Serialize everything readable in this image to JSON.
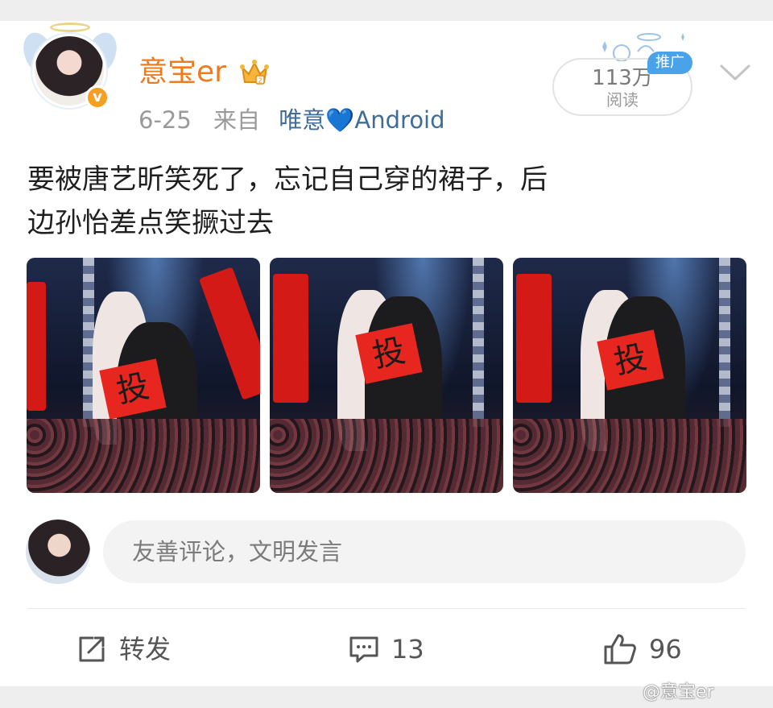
{
  "post": {
    "author": "意宝er",
    "date": "6-25",
    "source_prefix": "来自",
    "device_name": "唯意",
    "device_heart": "💙",
    "device_os": "Android",
    "views_count": "113万",
    "views_label": "阅读",
    "promo_badge": "推广",
    "text_line1": "要被唐艺昕笑死了，忘记自己穿的裙子，后",
    "text_line2": "边孙怡差点笑撅过去",
    "photos": [
      {
        "sign_char": "投"
      },
      {
        "sign_char": "投"
      },
      {
        "sign_char": "投"
      }
    ]
  },
  "comment": {
    "placeholder": "友善评论，文明发言"
  },
  "actions": {
    "repost_label": "转发",
    "comment_count": "13",
    "like_count": "96"
  },
  "watermark": "@意宝er",
  "colors": {
    "username": "#ef7b1f",
    "device_link": "#3f6d98",
    "promo": "#4aa3e8",
    "verified": "#f7a01f"
  },
  "icons": {
    "verified": "verified-v-icon",
    "crown": "member-crown-icon",
    "chevron": "chevron-down-icon",
    "repost": "repost-icon",
    "comment": "comment-icon",
    "like": "thumbs-up-icon"
  }
}
